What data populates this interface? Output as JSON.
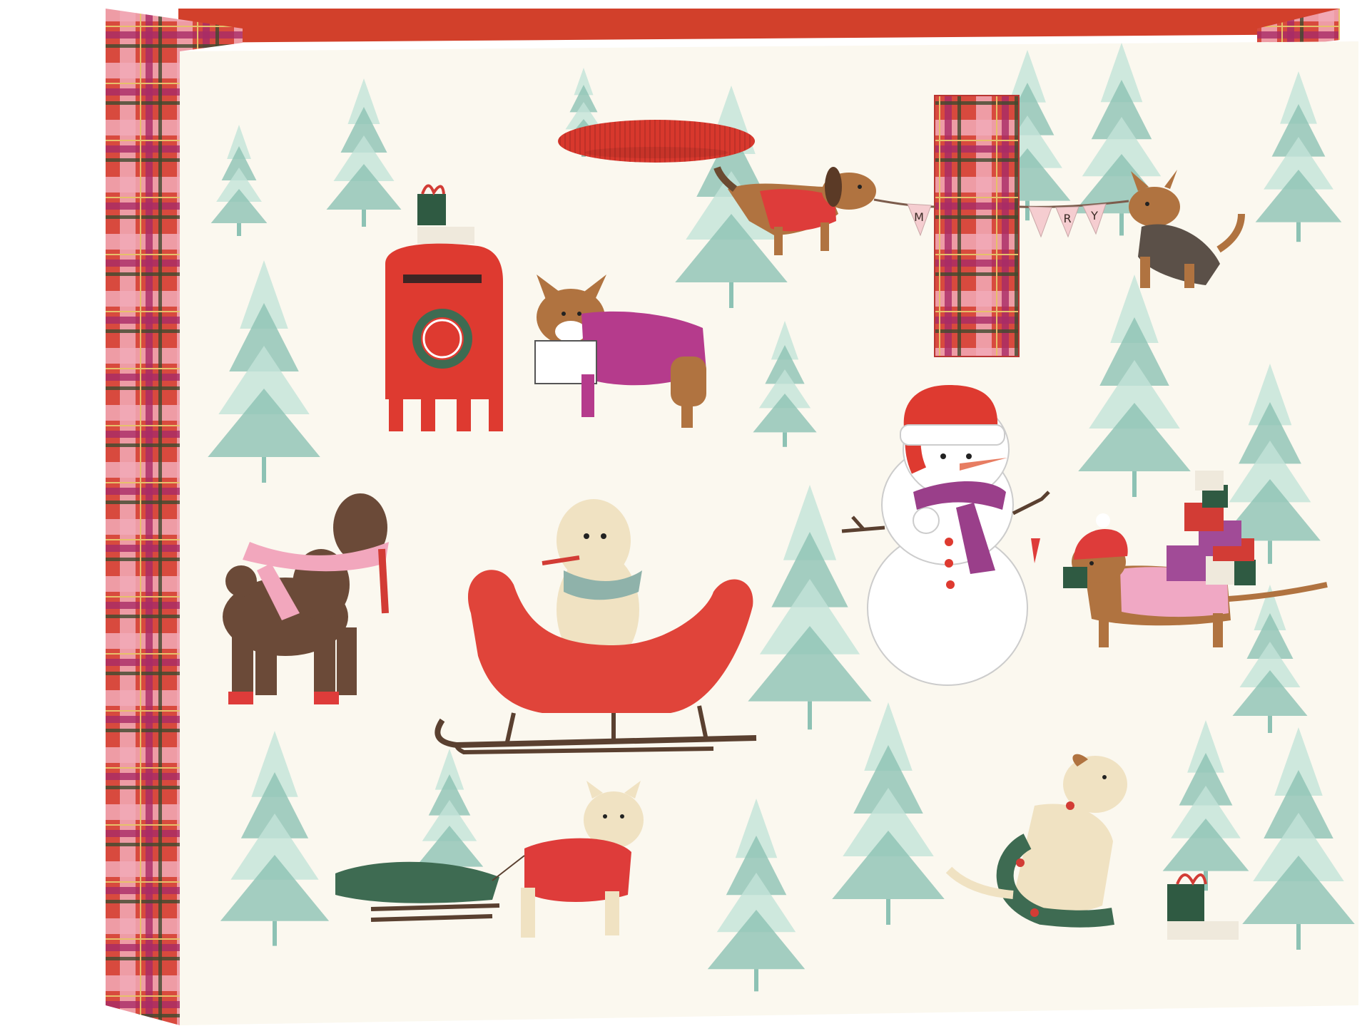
{
  "scene": {
    "subject": "gift-bag",
    "colors": {
      "background": "#ffffff",
      "bag_face": "#fbf8ef",
      "bag_interior": "#d2402b",
      "plaid_base": "#d84a3e",
      "plaid_pink": "#f2aab7",
      "plaid_magenta": "#a82a66",
      "plaid_green": "#3f4a2e",
      "plaid_gold": "#e6c06a",
      "ribbon_handle": "#d8382d",
      "tree_light": "#c3e3d8",
      "tree_dark": "#8dc2b4",
      "mailbox_red": "#de3a30",
      "sleigh_red": "#e0443a",
      "runner_brown": "#5a4030",
      "snow_white": "#ffffff",
      "scarf_purple": "#9a3f8a",
      "poodle_brown": "#6b4a38",
      "dog_tan": "#b07340",
      "dog_cream": "#f0e2c2",
      "wreath_green": "#3e6b52",
      "sweater_red": "#de3c3a",
      "sweater_magenta": "#b53b8c",
      "sweater_pink": "#f0a8c4",
      "scarf_pink": "#f2a7bd",
      "scarf_teal": "#8fb2aa",
      "gift_green": "#2f5a42",
      "gift_red": "#d23c35",
      "gift_purple": "#a14b97",
      "gift_cream": "#efe9dc",
      "banner_pink": "#f5cdd0"
    },
    "banner_letters": [
      "M",
      "R",
      "Y"
    ]
  }
}
